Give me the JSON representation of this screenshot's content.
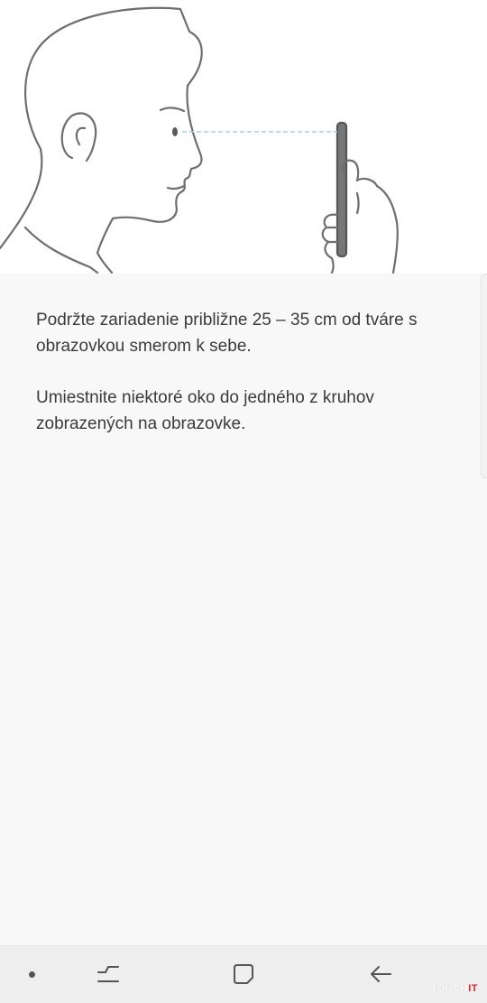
{
  "instructions": {
    "paragraph_1": "Podržte zariadenie približne 25 – 35 cm od tváre s obrazovkou smerom k sebe.",
    "paragraph_2": "Umiestnite niektoré oko do jedného z kruhov zobrazených na obrazovke."
  },
  "illustration": {
    "icon": "face-to-phone-illustration",
    "gaze_line_color": "#9fd1e3"
  },
  "navbar": {
    "pin_icon": "dot-icon",
    "recent_icon": "recent-apps-icon",
    "home_icon": "home-icon",
    "back_icon": "back-arrow-icon"
  },
  "watermark": {
    "part_1": "TOUCH",
    "part_2": "IT"
  }
}
